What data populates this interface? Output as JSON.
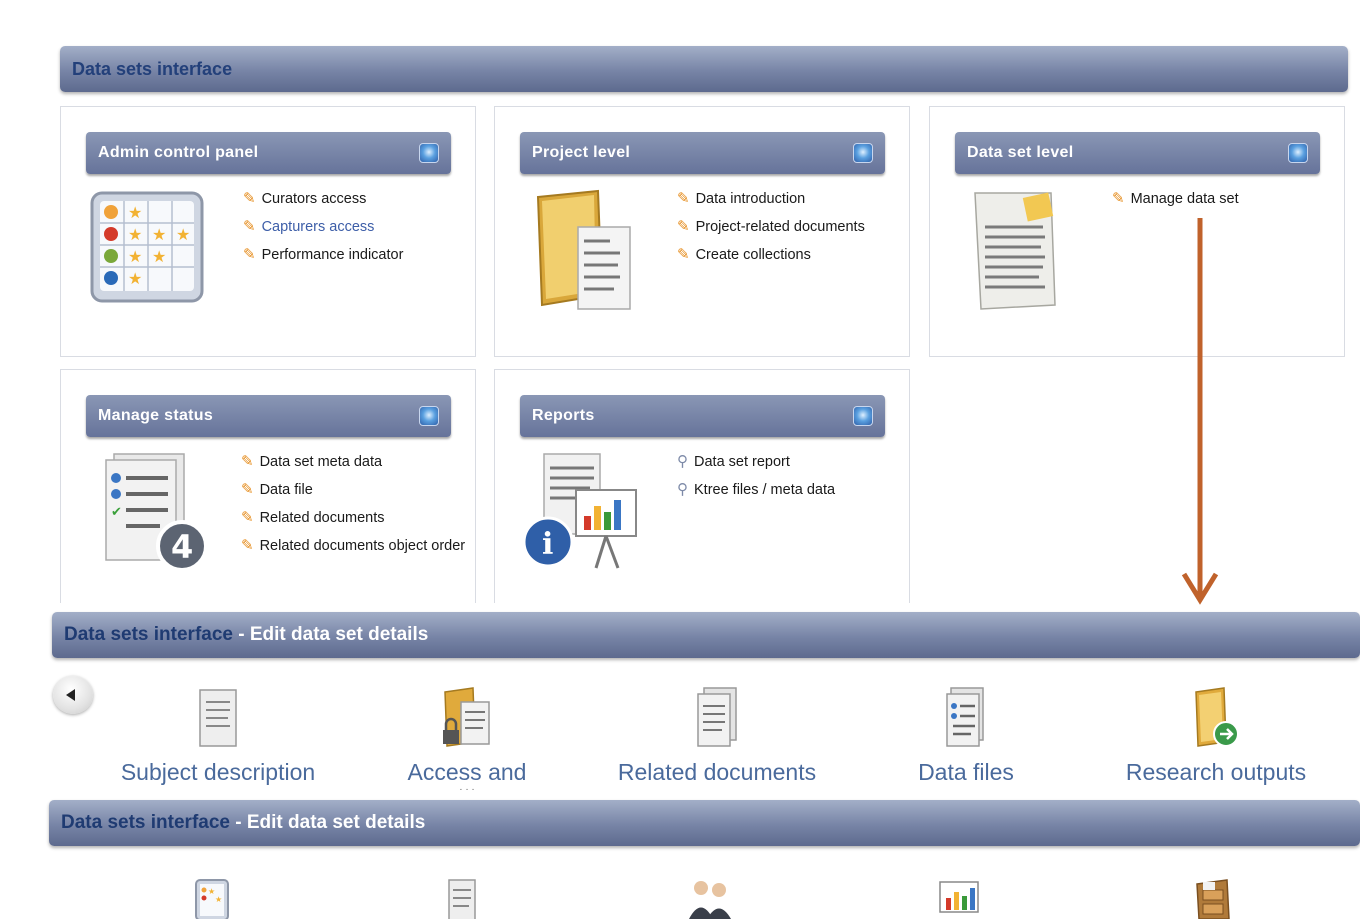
{
  "top_bar": {
    "title": "Data sets interface"
  },
  "panels": {
    "admin": {
      "title": "Admin control panel",
      "links": [
        "Curators access",
        "Capturers access",
        "Performance indicator"
      ]
    },
    "project": {
      "title": "Project level",
      "links": [
        "Data introduction",
        "Project-related documents",
        "Create collections"
      ]
    },
    "dataset": {
      "title": "Data set level",
      "links": [
        "Manage data set"
      ]
    },
    "status": {
      "title": "Manage status",
      "links": [
        "Data set meta data",
        "Data file",
        "Related documents",
        "Related documents object order"
      ]
    },
    "reports": {
      "title": "Reports",
      "links": [
        "Data set report",
        "Ktree files / meta data"
      ]
    }
  },
  "edit_bar_1": {
    "link": "Data sets interface",
    "rest": " - Edit data set details"
  },
  "tiles": [
    {
      "label": "Subject description",
      "icon": "document-icon"
    },
    {
      "label": "Access and",
      "icon": "folder-lock-icon"
    },
    {
      "label": "Related documents",
      "icon": "documents-icon"
    },
    {
      "label": "Data files",
      "icon": "data-file-icon"
    },
    {
      "label": "Research outputs",
      "icon": "folder-arrow-icon"
    }
  ],
  "edit_bar_2": {
    "link": "Data sets interface",
    "rest": " - Edit data set details"
  },
  "colors": {
    "bar_top": "#a3afc8",
    "bar_bottom": "#5d6a8e",
    "link_blue": "#4a6a9c",
    "arrow": "#c0622b",
    "pencil": "#e58b1a"
  }
}
